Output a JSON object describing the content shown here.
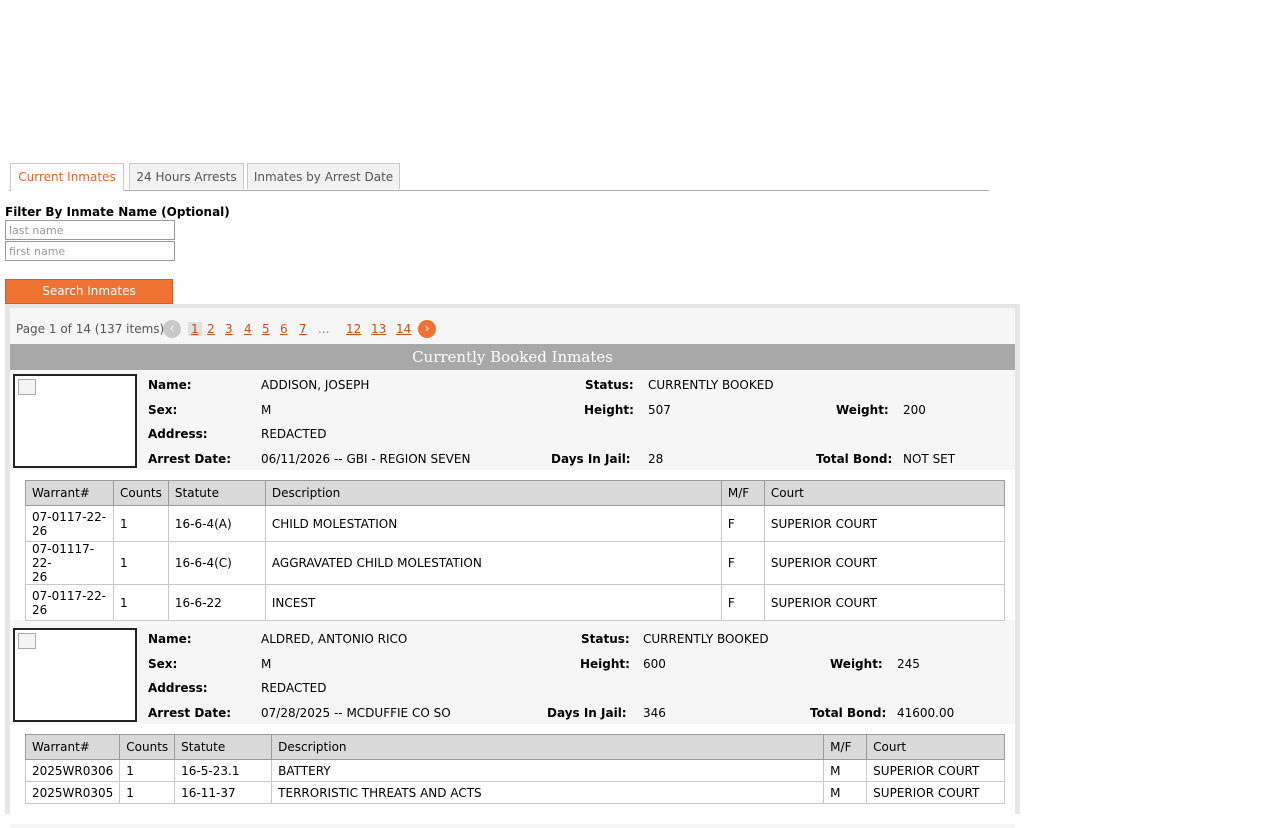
{
  "tabs": [
    {
      "label": "Current Inmates",
      "active": true
    },
    {
      "label": "24 Hours Arrests",
      "active": false
    },
    {
      "label": "Inmates by Arrest Date",
      "active": false
    }
  ],
  "filter": {
    "label": "Filter By Inmate Name (Optional)",
    "last_name_placeholder": "last name",
    "first_name_placeholder": "first name",
    "search_button": "Search Inmates"
  },
  "pager": {
    "info": "Page 1 of 14 (137 items)",
    "pages": [
      "1",
      "2",
      "3",
      "4",
      "5",
      "6",
      "7"
    ],
    "ellipsis": "...",
    "tail_pages": [
      "12",
      "13",
      "14"
    ],
    "prev_icon": "chevron-left",
    "next_icon": "chevron-right"
  },
  "header": "Currently Booked Inmates",
  "labels": {
    "name": "Name:",
    "sex": "Sex:",
    "address": "Address:",
    "arrest_date": "Arrest Date:",
    "status": "Status:",
    "height": "Height:",
    "weight": "Weight:",
    "days_in_jail": "Days In Jail:",
    "total_bond": "Total Bond:"
  },
  "columns": [
    "Warrant#",
    "Counts",
    "Statute",
    "Description",
    "M/F",
    "Court"
  ],
  "inmates": [
    {
      "name": "ADDISON, JOSEPH",
      "sex": "M",
      "address": "REDACTED",
      "arrest_date": "06/11/2026 -- GBI - REGION SEVEN",
      "status": "CURRENTLY BOOKED",
      "height": "507",
      "weight": "200",
      "days_in_jail": "28",
      "total_bond": "NOT SET",
      "charges": [
        {
          "warrant": "07-0117-22-\n26",
          "counts": "1",
          "statute": "16-6-4(A)",
          "description": "CHILD MOLESTATION",
          "mf": "F",
          "court": "SUPERIOR COURT"
        },
        {
          "warrant": "07-01117-22-\n26",
          "counts": "1",
          "statute": "16-6-4(C)",
          "description": "AGGRAVATED CHILD MOLESTATION",
          "mf": "F",
          "court": "SUPERIOR COURT"
        },
        {
          "warrant": "07-0117-22-\n26",
          "counts": "1",
          "statute": "16-6-22",
          "description": "INCEST",
          "mf": "F",
          "court": "SUPERIOR COURT"
        }
      ]
    },
    {
      "name": "ALDRED, ANTONIO RICO",
      "sex": "M",
      "address": "REDACTED",
      "arrest_date": "07/28/2025 -- MCDUFFIE CO SO",
      "status": "CURRENTLY BOOKED",
      "height": "600",
      "weight": "245",
      "days_in_jail": "346",
      "total_bond": "41600.00",
      "charges": [
        {
          "warrant": "2025WR0306",
          "counts": "1",
          "statute": "16-5-23.1",
          "description": "BATTERY",
          "mf": "M",
          "court": "SUPERIOR COURT"
        },
        {
          "warrant": "2025WR0305",
          "counts": "1",
          "statute": "16-11-37",
          "description": "TERRORISTIC THREATS AND ACTS",
          "mf": "M",
          "court": "SUPERIOR COURT"
        }
      ]
    }
  ]
}
